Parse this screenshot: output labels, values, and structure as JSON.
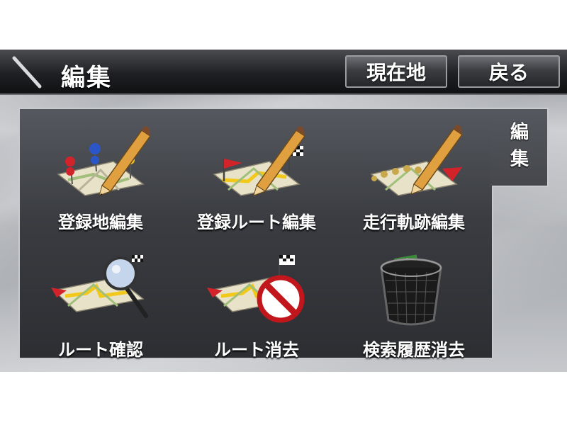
{
  "header": {
    "title": "編集",
    "current_location_label": "現在地",
    "back_label": "戻る"
  },
  "side_tab": {
    "chars": [
      "編",
      "集"
    ]
  },
  "tiles": [
    {
      "label": "登録地編集",
      "icon": "registered-point-edit-icon"
    },
    {
      "label": "登録ルート編集",
      "icon": "registered-route-edit-icon"
    },
    {
      "label": "走行軌跡編集",
      "icon": "driving-track-edit-icon"
    },
    {
      "label": "ルート確認",
      "icon": "route-check-icon"
    },
    {
      "label": "ルート消去",
      "icon": "route-delete-icon"
    },
    {
      "label": "検索履歴消去",
      "icon": "search-history-delete-icon"
    }
  ]
}
